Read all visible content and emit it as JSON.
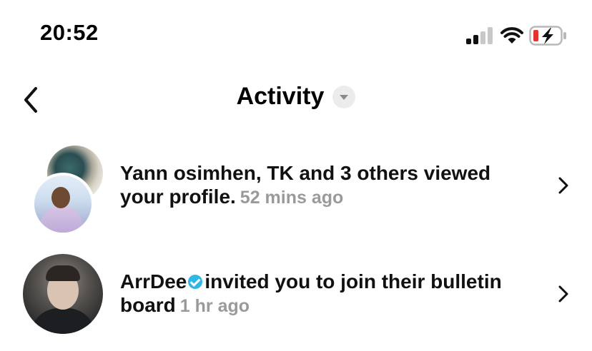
{
  "status_bar": {
    "time": "20:52",
    "signal_icon": "cellular-signal-icon",
    "wifi_icon": "wifi-icon",
    "battery_icon": "battery-low-charging-icon",
    "battery_low_color": "#e5342c"
  },
  "header": {
    "back_icon": "chevron-left-icon",
    "title": "Activity",
    "dropdown_icon": "caret-down-icon"
  },
  "activities": [
    {
      "text": "Yann osimhen, TK and 3 others viewed your profile.",
      "time": "52 mins ago",
      "chevron_icon": "chevron-right-icon"
    },
    {
      "name": "ArrDee",
      "verified_color": "#2fb7e8",
      "text": "invited you to join their bulletin board",
      "time": "1 hr ago",
      "chevron_icon": "chevron-right-icon"
    }
  ],
  "colors": {
    "time_ago": "#9a9a9a",
    "text": "#111111",
    "background": "#ffffff"
  }
}
